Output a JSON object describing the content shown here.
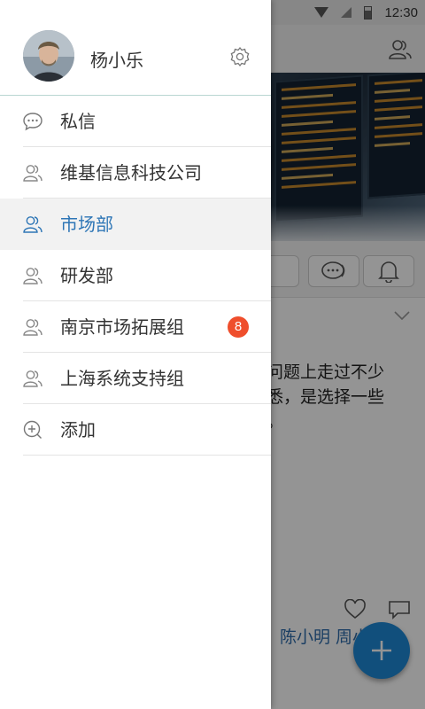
{
  "status_bar": {
    "time": "12:30"
  },
  "drawer": {
    "user_name": "杨小乐",
    "menu": [
      {
        "label": "私信",
        "icon": "message-icon"
      },
      {
        "label": "维基信息科技公司",
        "icon": "group-icon"
      },
      {
        "label": "市场部",
        "icon": "group-icon",
        "active": true
      },
      {
        "label": "研发部",
        "icon": "group-icon"
      },
      {
        "label": "南京市场拓展组",
        "icon": "group-icon",
        "badge": "8"
      },
      {
        "label": "上海系统支持组",
        "icon": "group-icon"
      },
      {
        "label": "添加",
        "icon": "add-circle-icon"
      }
    ]
  },
  "background": {
    "post_text": "的问题上走过不少\n熟悉，是选择一些\n格。",
    "post_names": "陈小明  周小明"
  },
  "colors": {
    "accent": "#2e76b6",
    "badge": "#ef4e2c",
    "fab": "#1e88d6"
  }
}
